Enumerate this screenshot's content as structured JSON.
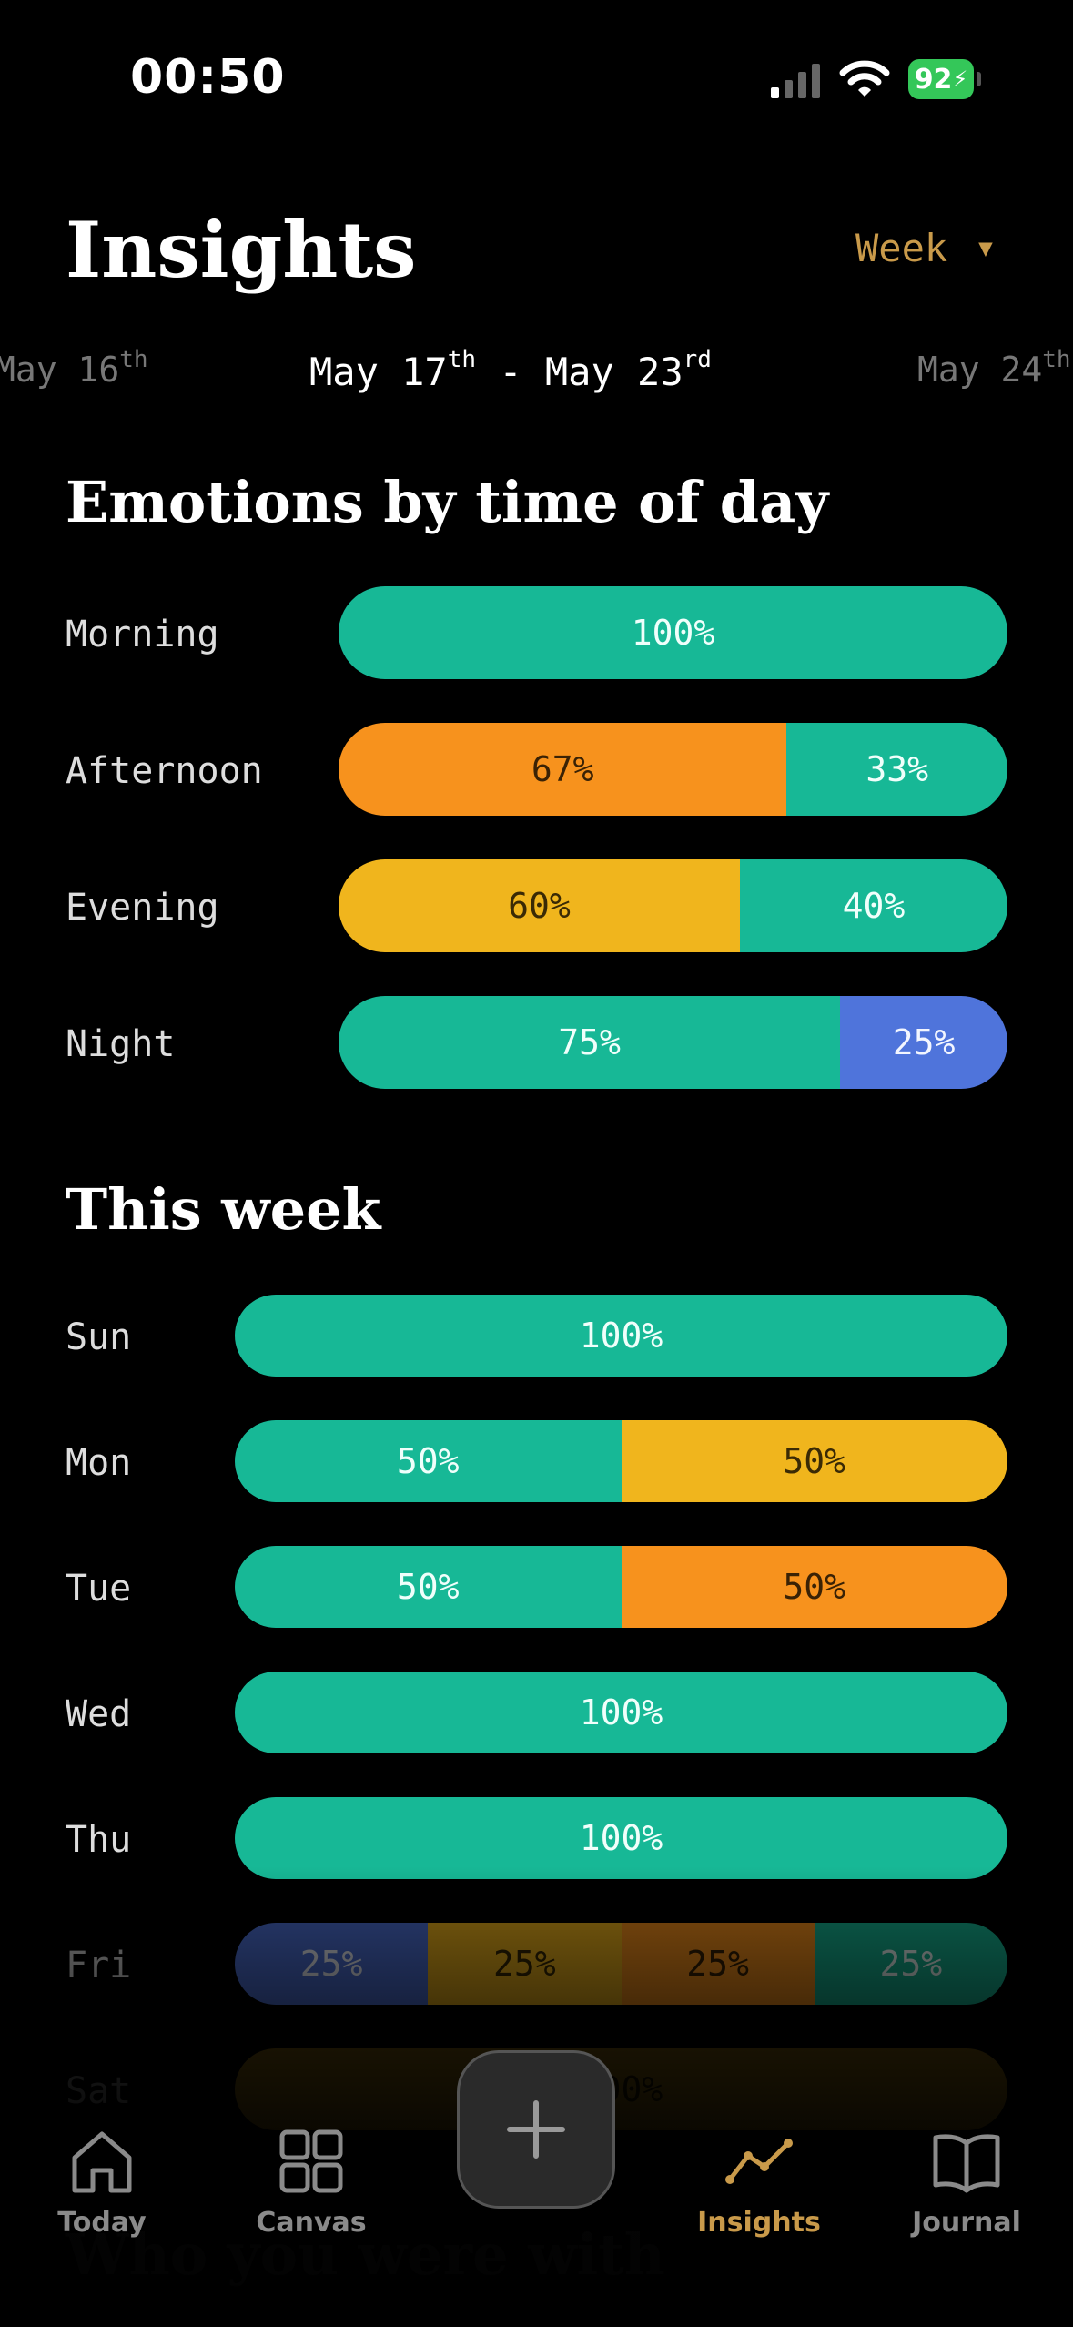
{
  "status_bar": {
    "time": "00:50",
    "battery": "92"
  },
  "header": {
    "title": "Insights",
    "range_label": "Week",
    "range_arrow": "▼"
  },
  "dates": {
    "prev": {
      "main": "May 16",
      "suffix": "th"
    },
    "current": {
      "start": "May 17",
      "start_suffix": "th",
      "sep": " - ",
      "end": "May 23",
      "end_suffix": "rd"
    },
    "next": {
      "main": "May 24",
      "suffix": "th"
    }
  },
  "emotions_by_time": {
    "title": "Emotions by time of day",
    "rows": [
      {
        "label": "Morning",
        "segments": [
          {
            "percent": 100,
            "label": "100%",
            "color": "teal"
          }
        ]
      },
      {
        "label": "Afternoon",
        "segments": [
          {
            "percent": 67,
            "label": "67%",
            "color": "orange"
          },
          {
            "percent": 33,
            "label": "33%",
            "color": "teal"
          }
        ]
      },
      {
        "label": "Evening",
        "segments": [
          {
            "percent": 60,
            "label": "60%",
            "color": "yellow"
          },
          {
            "percent": 40,
            "label": "40%",
            "color": "teal"
          }
        ]
      },
      {
        "label": "Night",
        "segments": [
          {
            "percent": 75,
            "label": "75%",
            "color": "teal"
          },
          {
            "percent": 25,
            "label": "25%",
            "color": "blue"
          }
        ]
      }
    ]
  },
  "this_week": {
    "title": "This week",
    "rows": [
      {
        "label": "Sun",
        "segments": [
          {
            "percent": 100,
            "label": "100%",
            "color": "teal"
          }
        ]
      },
      {
        "label": "Mon",
        "segments": [
          {
            "percent": 50,
            "label": "50%",
            "color": "teal"
          },
          {
            "percent": 50,
            "label": "50%",
            "color": "yellow"
          }
        ]
      },
      {
        "label": "Tue",
        "segments": [
          {
            "percent": 50,
            "label": "50%",
            "color": "teal"
          },
          {
            "percent": 50,
            "label": "50%",
            "color": "orange"
          }
        ]
      },
      {
        "label": "Wed",
        "segments": [
          {
            "percent": 100,
            "label": "100%",
            "color": "teal"
          }
        ]
      },
      {
        "label": "Thu",
        "segments": [
          {
            "percent": 100,
            "label": "100%",
            "color": "teal"
          }
        ]
      },
      {
        "label": "Fri",
        "segments": [
          {
            "percent": 25,
            "label": "25%",
            "color": "blue"
          },
          {
            "percent": 25,
            "label": "25%",
            "color": "yellow"
          },
          {
            "percent": 25,
            "label": "25%",
            "color": "orange"
          },
          {
            "percent": 25,
            "label": "25%",
            "color": "teal"
          }
        ]
      },
      {
        "label": "Sat",
        "segments": [
          {
            "percent": 100,
            "label": "100%",
            "color": "yellow"
          }
        ]
      }
    ]
  },
  "next_section_title": "Who you were with",
  "tab_bar": {
    "today": "Today",
    "canvas": "Canvas",
    "insights": "Insights",
    "journal": "Journal",
    "add_icon": "plus-icon"
  },
  "colors": {
    "accent": "#c99a4a",
    "teal": "#17b896",
    "orange": "#f7921d",
    "yellow": "#f0b51d",
    "blue": "#4f74db"
  }
}
